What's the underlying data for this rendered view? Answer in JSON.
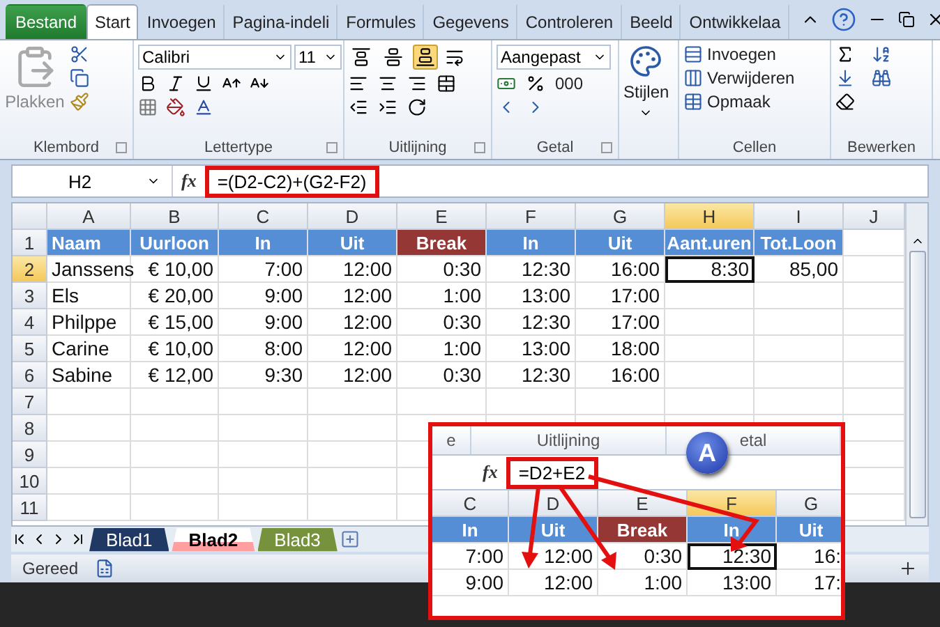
{
  "ribbon_tabs": [
    {
      "label": "Bestand",
      "kind": "file",
      "selected": false
    },
    {
      "label": "Start",
      "kind": "tab",
      "selected": true
    },
    {
      "label": "Invoegen",
      "kind": "tab",
      "selected": false
    },
    {
      "label": "Pagina-indeli",
      "kind": "tab",
      "selected": false
    },
    {
      "label": "Formules",
      "kind": "tab",
      "selected": false
    },
    {
      "label": "Gegevens",
      "kind": "tab",
      "selected": false
    },
    {
      "label": "Controleren",
      "kind": "tab",
      "selected": false
    },
    {
      "label": "Beeld",
      "kind": "tab",
      "selected": false
    },
    {
      "label": "Ontwikkelaa",
      "kind": "tab",
      "selected": false
    }
  ],
  "ribbon": {
    "clipboard": {
      "paste_label": "Plakken",
      "group_label": "Klembord"
    },
    "font": {
      "name": "Calibri",
      "size": "11",
      "group_label": "Lettertype"
    },
    "alignment": {
      "group_label": "Uitlijning"
    },
    "number": {
      "format": "Aangepast",
      "thousands": "000",
      "group_label": "Getal"
    },
    "styles": {
      "label": "Stijlen"
    },
    "cells": {
      "commands": [
        "Invoegen",
        "Verwijderen",
        "Opmaak"
      ],
      "group_label": "Cellen"
    },
    "editing": {
      "group_label": "Bewerken"
    }
  },
  "formula_bar": {
    "name_box": "H2",
    "function_label": "fx",
    "formula": "=(D2-C2)+(G2-F2)"
  },
  "columns": [
    {
      "label": "A",
      "selected": false
    },
    {
      "label": "B",
      "selected": false
    },
    {
      "label": "C",
      "selected": false
    },
    {
      "label": "D",
      "selected": false
    },
    {
      "label": "E",
      "selected": false
    },
    {
      "label": "F",
      "selected": false
    },
    {
      "label": "G",
      "selected": false
    },
    {
      "label": "H",
      "selected": true
    },
    {
      "label": "I",
      "selected": false
    },
    {
      "label": "J",
      "selected": false
    }
  ],
  "rows": [
    {
      "number": "1",
      "selected": false,
      "cells": [
        {
          "text": "Naam",
          "color": "#558ed5"
        },
        {
          "text": "Uurloon",
          "color": "#558ed5"
        },
        {
          "text": "In",
          "color": "#558ed5"
        },
        {
          "text": "Uit",
          "color": "#558ed5"
        },
        {
          "text": "Break",
          "color": "#953735"
        },
        {
          "text": "In",
          "color": "#558ed5"
        },
        {
          "text": "Uit",
          "color": "#558ed5"
        },
        {
          "text": "Aant.uren",
          "color": "#558ed5"
        },
        {
          "text": "Tot.Loon",
          "color": "#558ed5"
        }
      ]
    },
    {
      "number": "2",
      "selected": true,
      "cells": [
        "Janssens",
        "€ 10,00",
        "7:00",
        "12:00",
        "0:30",
        "12:30",
        "16:00",
        "8:30",
        "85,00"
      ]
    },
    {
      "number": "3",
      "selected": false,
      "cells": [
        "Els",
        "€ 20,00",
        "9:00",
        "12:00",
        "1:00",
        "13:00",
        "17:00"
      ]
    },
    {
      "number": "4",
      "selected": false,
      "cells": [
        "Philppe",
        "€ 15,00",
        "9:00",
        "12:00",
        "0:30",
        "12:30",
        "17:00"
      ]
    },
    {
      "number": "5",
      "selected": false,
      "cells": [
        "Carine",
        "€ 10,00",
        "8:00",
        "12:00",
        "1:00",
        "13:00",
        "18:00"
      ]
    },
    {
      "number": "6",
      "selected": false,
      "cells": [
        "Sabine",
        "€ 12,00",
        "9:30",
        "12:00",
        "0:30",
        "12:30",
        "16:00"
      ]
    },
    {
      "number": "7",
      "selected": false,
      "cells": []
    },
    {
      "number": "8",
      "selected": false,
      "cells": []
    },
    {
      "number": "9",
      "selected": false,
      "cells": []
    },
    {
      "number": "10",
      "selected": false,
      "cells": []
    },
    {
      "number": "11",
      "selected": false,
      "cells": []
    }
  ],
  "sheet_tabs": [
    {
      "label": "Blad1",
      "selected": false,
      "color": "#1f3864"
    },
    {
      "label": "Blad2",
      "selected": true,
      "color": "#ff9f9f"
    },
    {
      "label": "Blad3",
      "selected": false,
      "color": "#76923c"
    }
  ],
  "status_bar": {
    "text": "Gereed"
  },
  "inset": {
    "group_labels": [
      "e",
      "Uitlijning",
      "etal"
    ],
    "badge": "A",
    "function_label": "fx",
    "formula": "=D2+E2",
    "columns": [
      {
        "label": "C",
        "selected": false
      },
      {
        "label": "D",
        "selected": false
      },
      {
        "label": "E",
        "selected": false
      },
      {
        "label": "F",
        "selected": true
      },
      {
        "label": "G",
        "selected": false
      }
    ],
    "header": [
      {
        "text": "In",
        "color": "#558ed5"
      },
      {
        "text": "Uit",
        "color": "#558ed5"
      },
      {
        "text": "Break",
        "color": "#953735"
      },
      {
        "text": "In",
        "color": "#558ed5"
      },
      {
        "text": "Uit",
        "color": "#558ed5"
      }
    ],
    "rows": [
      {
        "selected": true,
        "cells": [
          "7:00",
          "12:00",
          "0:30",
          "12:30",
          "16:"
        ]
      },
      {
        "selected": false,
        "cells": [
          "9:00",
          "12:00",
          "1:00",
          "13:00",
          "17:"
        ]
      }
    ]
  }
}
